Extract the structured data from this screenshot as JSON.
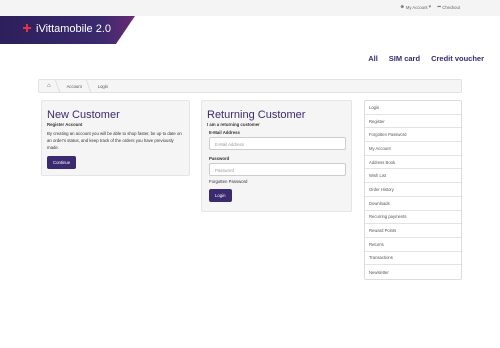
{
  "topbar": {
    "my_account": "My Account",
    "checkout": "Checkout"
  },
  "brand": {
    "name": "iVittamobile 2.0",
    "color": "#3b2a6f"
  },
  "nav": {
    "items": [
      "All",
      "SIM card",
      "Credit voucher"
    ]
  },
  "breadcrumb": {
    "home_icon": "home-icon",
    "items": [
      "Account",
      "Login"
    ]
  },
  "new_customer": {
    "title": "New Customer",
    "subtitle": "Register Account",
    "description": "By creating an account you will be able to shop faster, be up to date on an order's status, and keep track of the orders you have previously made.",
    "button": "Continue"
  },
  "returning_customer": {
    "title": "Returning Customer",
    "subtitle": "I am a returning customer",
    "email_label": "E-Mail Address",
    "email_placeholder": "E-Mail Address",
    "password_label": "Password",
    "password_placeholder": "Password",
    "forgot": "Forgotten Password",
    "button": "Login"
  },
  "sidebar": {
    "items": [
      "Login",
      "Register",
      "Forgotten Password",
      "My Account",
      "Address Book",
      "Wish List",
      "Order History",
      "Downloads",
      "Recurring payments",
      "Reward Points",
      "Returns",
      "Transactions",
      "Newsletter"
    ]
  }
}
